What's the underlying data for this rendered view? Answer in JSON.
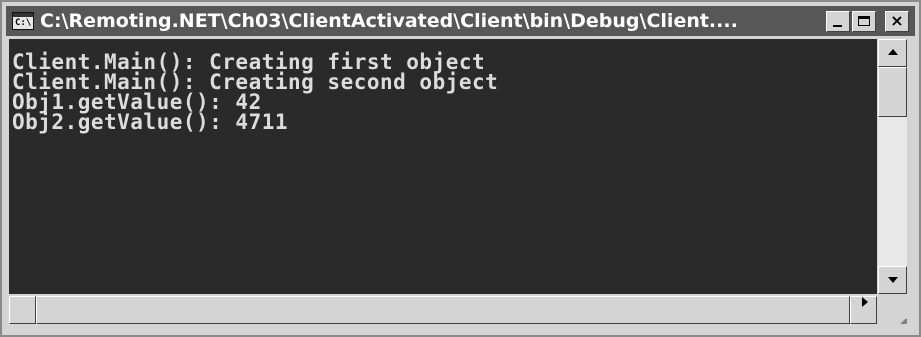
{
  "window": {
    "title": "C:\\Remoting.NET\\Ch03\\ClientActivated\\Client\\bin\\Debug\\Client....",
    "sys_icon_glyph": "C:\\",
    "buttons": {
      "minimize": "minimize-icon",
      "maximize": "maximize-icon",
      "close": "×"
    }
  },
  "console": {
    "lines": [
      "Client.Main(): Creating first object",
      "Client.Main(): Creating second object",
      "Obj1.getValue(): 42",
      "Obj2.getValue(): 4711"
    ]
  },
  "colors": {
    "title_bar": "#575757",
    "console_bg": "#2a2a2a",
    "console_text": "#dcdcdc",
    "chrome": "#d4d4d4"
  }
}
